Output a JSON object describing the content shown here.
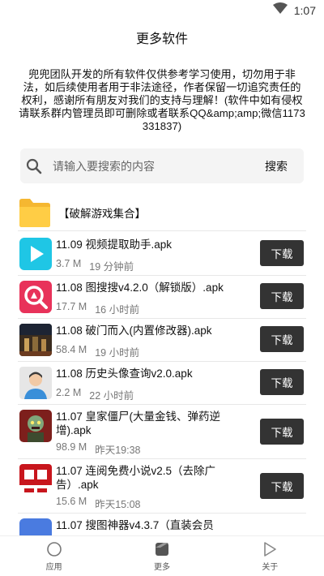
{
  "status_bar": {
    "time": "1:07"
  },
  "header": {
    "title": "更多软件"
  },
  "notice": "兜兜团队开发的所有软件仅供参考学习使用，切勿用于非法，如后续使用者用于非法途径，作者保留一切追究责任的权利，感谢所有朋友对我们的支持与理解！(软件中如有侵权请联系群内管理员即可删除或者联系QQ&amp;amp;微信1173331837)",
  "search": {
    "placeholder": "请输入要搜索的内容",
    "button_label": "搜索"
  },
  "folder": {
    "label": "【破解游戏集合】"
  },
  "download_label": "下载",
  "files": [
    {
      "name": "11.09 视频提取助手.apk",
      "size": "3.7 M",
      "time": "19 分钟前",
      "icon": "video-extract-icon"
    },
    {
      "name": "11.08 图搜搜v4.2.0（解锁版）.apk",
      "size": "17.7 M",
      "time": "16 小时前",
      "icon": "image-search-icon"
    },
    {
      "name": "11.08 破门而入(内置修改器).apk",
      "size": "58.4 M",
      "time": "19 小时前",
      "icon": "door-kickers-icon"
    },
    {
      "name": "11.08 历史头像查询v2.0.apk",
      "size": "2.2 M",
      "time": "22 小时前",
      "icon": "avatar-history-icon"
    },
    {
      "name": "11.07 皇家僵尸(大量金钱、弹药逆增).apk",
      "size": "98.9 M",
      "time": "昨天19:38",
      "icon": "zombie-game-icon"
    },
    {
      "name": "11.07 连阅免费小说v2.5（去除广告）.apk",
      "size": "15.6 M",
      "time": "昨天15:08",
      "icon": "novel-app-icon"
    },
    {
      "name": "11.07 搜图神器v4.3.7（直装会员",
      "icon": "image-search-tool-icon"
    }
  ],
  "nav": [
    {
      "label": "应用",
      "icon": "apps-icon"
    },
    {
      "label": "更多",
      "icon": "more-icon"
    },
    {
      "label": "关于",
      "icon": "about-icon"
    }
  ],
  "colors": {
    "download_button": "#333333",
    "folder": "#ffc83d",
    "search_bg": "#f4f4f4"
  }
}
